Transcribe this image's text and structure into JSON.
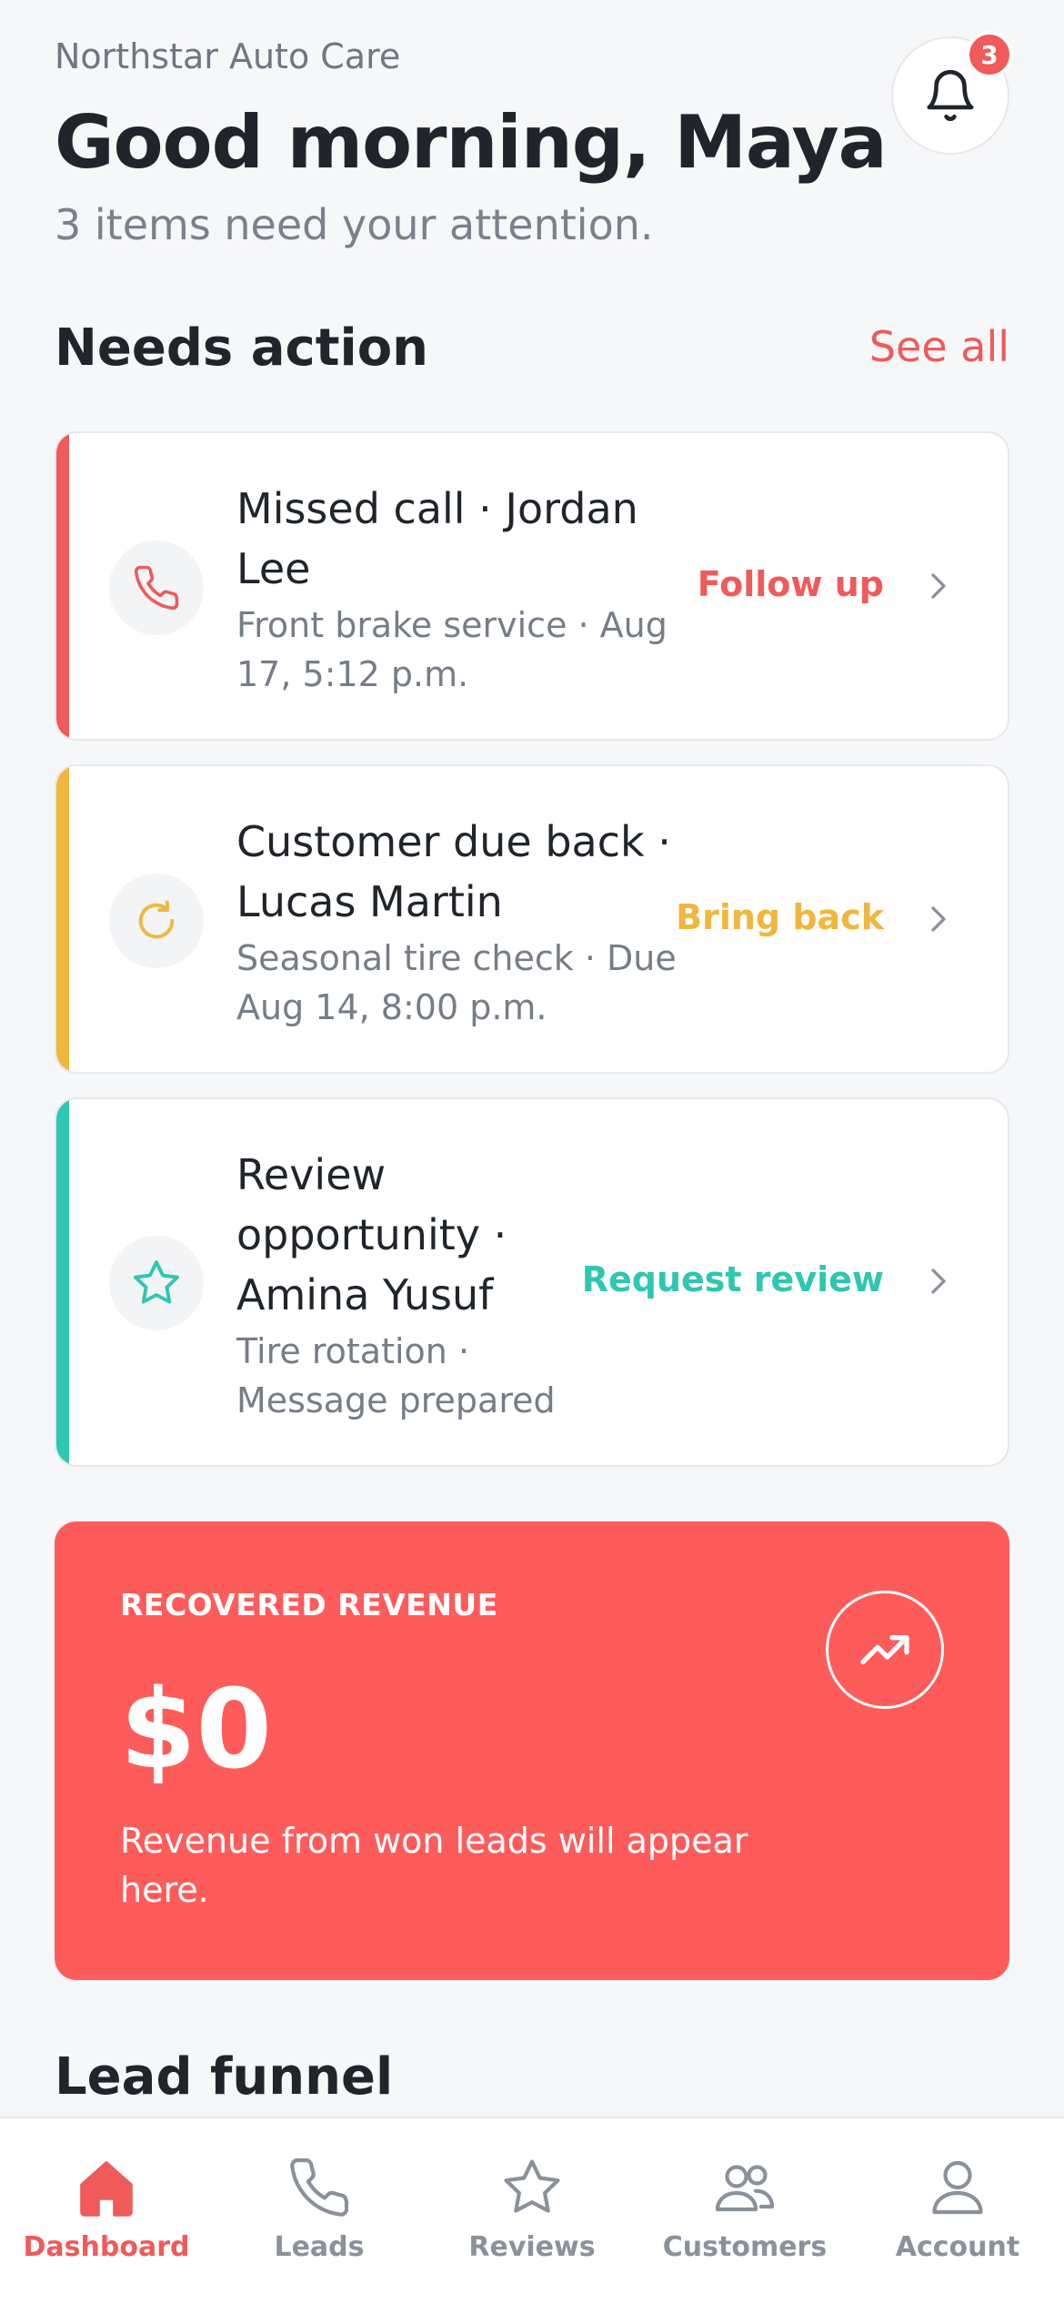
{
  "header": {
    "business_name": "Northstar Auto Care",
    "greeting": "Good morning, Maya",
    "summary": "3 items need your attention.",
    "notification_count": "3"
  },
  "needs_action": {
    "title": "Needs action",
    "see_all": "See all",
    "items": [
      {
        "title": "Missed call · Jordan Lee",
        "subtitle": "Front brake service · Aug 17, 5:12 p.m.",
        "action": "Follow up",
        "icon": "phone-icon",
        "color": "#f05a5a"
      },
      {
        "title": "Customer due back · Lucas Martin",
        "subtitle": "Seasonal tire check · Due Aug 14, 8:00 p.m.",
        "action": "Bring back",
        "icon": "refresh-icon",
        "color": "#f0b73e"
      },
      {
        "title": "Review opportunity · Amina Yusuf",
        "subtitle": "Tire rotation · Message prepared",
        "action": "Request review",
        "icon": "star-icon",
        "color": "#2ec7b0"
      }
    ]
  },
  "revenue": {
    "label": "RECOVERED REVENUE",
    "value": "$0",
    "description": "Revenue from won leads will appear here.",
    "icon": "trending-up-icon",
    "background": "#fe5c5b"
  },
  "lead_funnel": {
    "title": "Lead funnel"
  },
  "tabbar": {
    "active": "Dashboard",
    "tabs": [
      {
        "label": "Dashboard",
        "icon": "home-icon"
      },
      {
        "label": "Leads",
        "icon": "phone-icon"
      },
      {
        "label": "Reviews",
        "icon": "star-icon"
      },
      {
        "label": "Customers",
        "icon": "users-icon"
      },
      {
        "label": "Account",
        "icon": "user-icon"
      }
    ]
  },
  "colors": {
    "accent": "#f05a5a",
    "warning": "#f0b73e",
    "success": "#2ec7b0",
    "text": "#20252c",
    "muted": "#767d87"
  }
}
